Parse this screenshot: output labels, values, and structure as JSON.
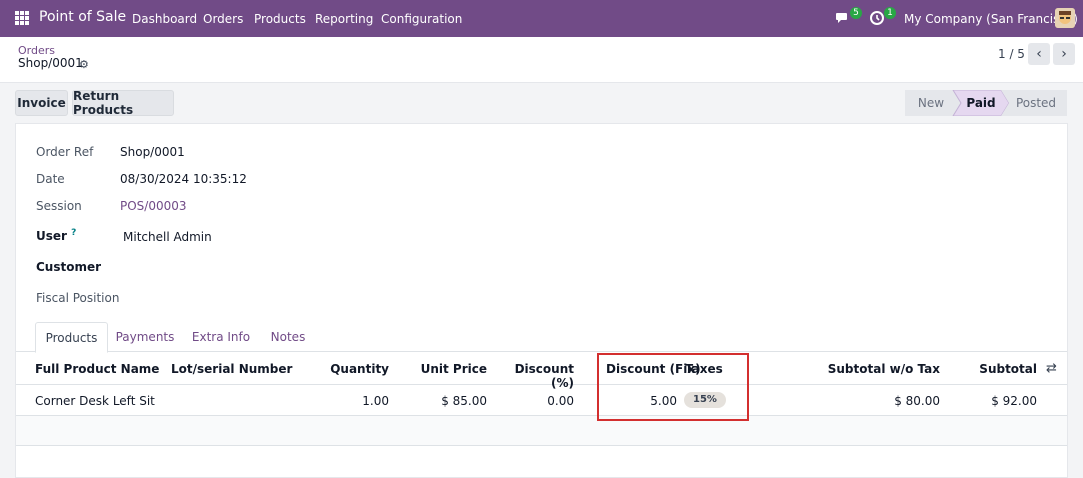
{
  "navbar": {
    "app_name": "Point of Sale",
    "menu": [
      "Dashboard",
      "Orders",
      "Products",
      "Reporting",
      "Configuration"
    ],
    "messages_count": "5",
    "activities_count": "1",
    "company": "My Company (San Francisco)"
  },
  "breadcrumb": {
    "parent": "Orders",
    "current": "Shop/0001"
  },
  "pager": {
    "text": "1 / 5"
  },
  "actions": {
    "invoice": "Invoice",
    "return_products": "Return Products"
  },
  "statusbar": {
    "states": [
      "New",
      "Paid",
      "Posted"
    ],
    "active": "Paid"
  },
  "form": {
    "order_ref_label": "Order Ref",
    "order_ref": "Shop/0001",
    "date_label": "Date",
    "date": "08/30/2024 10:35:12",
    "session_label": "Session",
    "session": "POS/00003",
    "user_label": "User",
    "user_help": "?",
    "user": "Mitchell Admin",
    "customer_label": "Customer",
    "fiscal_position_label": "Fiscal Position"
  },
  "tabs": [
    "Products",
    "Payments",
    "Extra Info",
    "Notes"
  ],
  "table": {
    "headers": [
      "Full Product Name",
      "Lot/serial Number",
      "Quantity",
      "Unit Price",
      "Discount (%)",
      "Discount (Fix)",
      "Taxes",
      "Subtotal w/o Tax",
      "Subtotal"
    ],
    "rows": [
      {
        "product": "Corner Desk Left Sit",
        "lot": "",
        "quantity": "1.00",
        "unit_price": "$ 85.00",
        "discount_pct": "0.00",
        "discount_fix": "5.00",
        "taxes": "15%",
        "subtotal_wo_tax": "$ 80.00",
        "subtotal": "$ 92.00"
      }
    ]
  },
  "colors": {
    "brand": "#714b87",
    "highlight": "#d32f2f"
  }
}
